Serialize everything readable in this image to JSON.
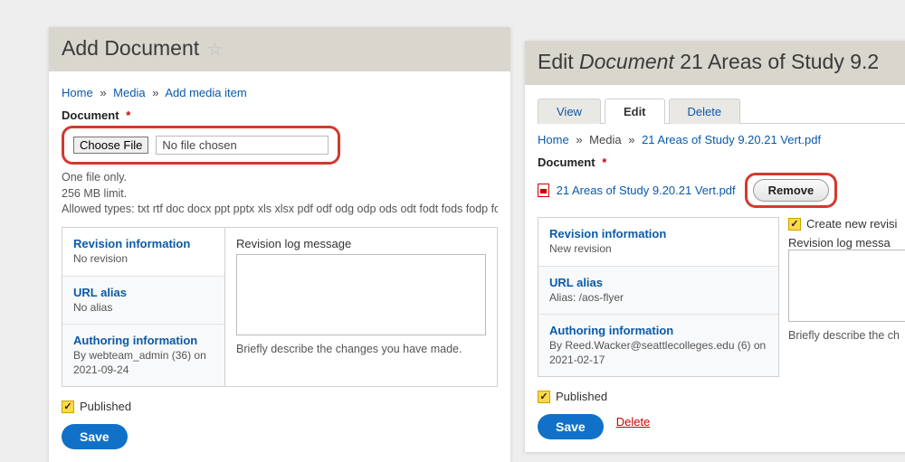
{
  "left": {
    "title": "Add Document",
    "breadcrumb": {
      "home": "Home",
      "media": "Media",
      "add": "Add media item"
    },
    "doc_label": "Document",
    "choose_file": "Choose File",
    "no_file": "No file chosen",
    "hint1": "One file only.",
    "hint2": "256 MB limit.",
    "hint3": "Allowed types: txt rtf doc docx ppt pptx xls xlsx pdf odf odg odp ods odt fodt fods fodp fodg key numbe",
    "tabs": {
      "revision": {
        "title": "Revision information",
        "sub": "No revision"
      },
      "url": {
        "title": "URL alias",
        "sub": "No alias"
      },
      "author": {
        "title": "Authoring information",
        "sub": "By webteam_admin (36) on 2021-09-24"
      }
    },
    "log_label": "Revision log message",
    "log_hint": "Briefly describe the changes you have made.",
    "published": "Published",
    "save": "Save"
  },
  "right": {
    "title_pre": "Edit ",
    "title_em": "Document",
    "title_post": " 21 Areas of Study 9.2",
    "htabs": {
      "view": "View",
      "edit": "Edit",
      "delete": "Delete"
    },
    "breadcrumb": {
      "home": "Home",
      "media": "Media",
      "file": "21 Areas of Study 9.20.21 Vert.pdf"
    },
    "doc_label": "Document",
    "file_link": "21 Areas of Study 9.20.21 Vert.pdf",
    "remove": "Remove",
    "tabs": {
      "revision": {
        "title": "Revision information",
        "sub": "New revision"
      },
      "url": {
        "title": "URL alias",
        "sub": "Alias: /aos-flyer"
      },
      "author": {
        "title": "Authoring information",
        "sub": "By Reed.Wacker@seattlecolleges.edu (6) on 2021-02-17"
      }
    },
    "create_new": "Create new revisi",
    "log_label": "Revision log messa",
    "log_hint": "Briefly describe the ch",
    "published": "Published",
    "save": "Save",
    "delete": "Delete"
  }
}
